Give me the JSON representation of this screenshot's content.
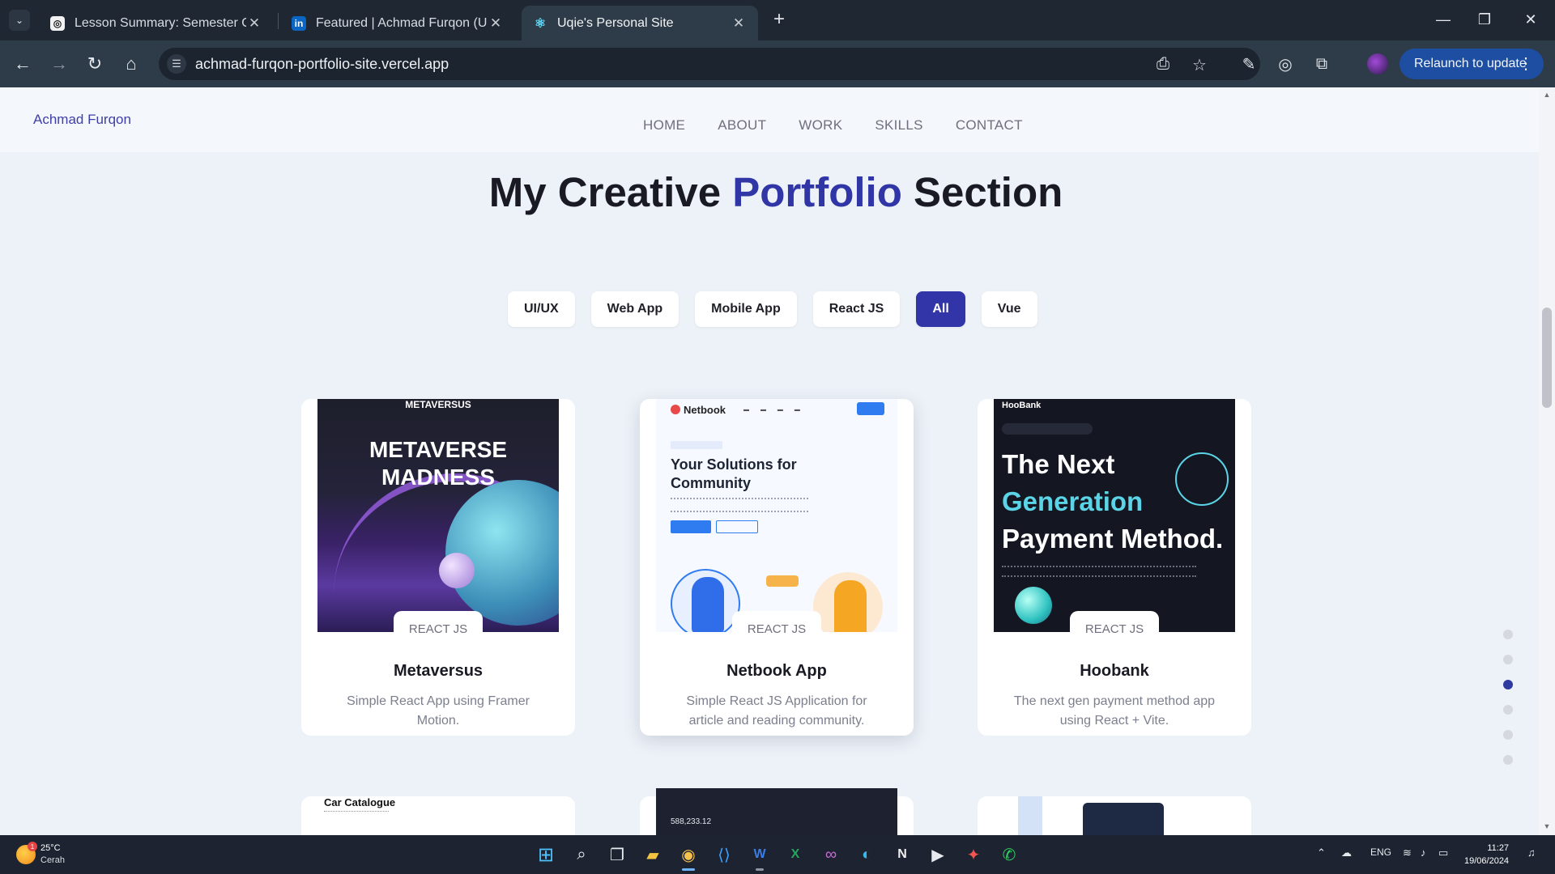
{
  "browser": {
    "tabs": [
      {
        "title": "Lesson Summary: Semester Ove",
        "favicon": "openai-icon"
      },
      {
        "title": "Featured | Achmad Furqon (Uq",
        "favicon": "linkedin-icon"
      },
      {
        "title": "Uqie's Personal Site",
        "favicon": "react-icon",
        "active": true
      }
    ],
    "url": "achmad-furqon-portfolio-site.vercel.app",
    "relaunch_label": "Relaunch to update"
  },
  "site": {
    "brand": "Achmad Furqon",
    "nav": [
      "HOME",
      "ABOUT",
      "WORK",
      "SKILLS",
      "CONTACT"
    ],
    "heading_pre": "My Creative ",
    "heading_accent": "Portfolio",
    "heading_post": " Section",
    "filters": [
      "UI/UX",
      "Web App",
      "Mobile App",
      "React JS",
      "All",
      "Vue"
    ],
    "active_filter": "All",
    "accent_color": "#3136a6"
  },
  "projects": [
    {
      "tag": "REACT JS",
      "title": "Metaversus",
      "desc": "Simple React App using Framer Motion.",
      "thumb": {
        "top": "METAVERSUS",
        "line1": "METAVERSE",
        "line2": "MADNESS"
      }
    },
    {
      "tag": "REACT JS",
      "title": "Netbook App",
      "desc": "Simple React JS Application for article and reading community.",
      "thumb": {
        "logo": "Netbook",
        "headline": "Your Solutions for Community"
      }
    },
    {
      "tag": "REACT JS",
      "title": "Hoobank",
      "desc": "The next gen payment method app using React + Vite.",
      "thumb": {
        "logo": "HooBank",
        "line1": "The Next",
        "line2": "Generation",
        "line3": "Payment Method."
      }
    }
  ],
  "row2": {
    "car_title": "Car Catalogue",
    "dash_value": "588,233.12"
  },
  "section_dots_active_index": 2,
  "taskbar": {
    "temperature": "25°C",
    "condition": "Cerah",
    "weather_badge": "1",
    "language": "ENG",
    "time": "11:27",
    "date": "19/06/2024"
  }
}
